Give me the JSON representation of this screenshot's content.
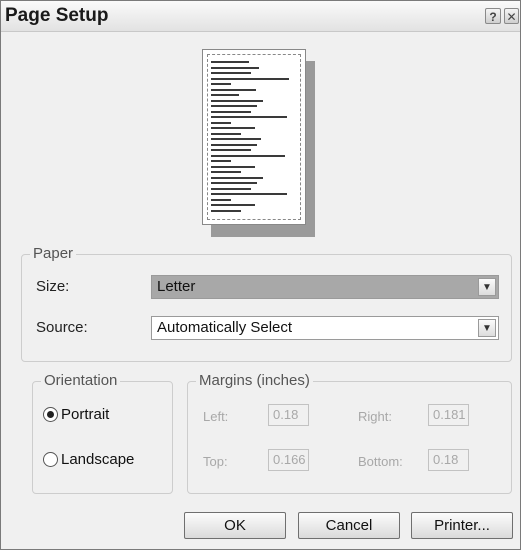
{
  "window": {
    "title": "Page Setup",
    "help_symbol": "?",
    "close_symbol": "✕"
  },
  "paper": {
    "legend": "Paper",
    "size_label": "Size:",
    "size_value": "Letter",
    "source_label": "Source:",
    "source_value": "Automatically Select"
  },
  "orientation": {
    "legend": "Orientation",
    "options": [
      "Portrait",
      "Landscape"
    ],
    "selected": "Portrait"
  },
  "margins": {
    "legend": "Margins (inches)",
    "left_label": "Left:",
    "left_value": "0.18",
    "right_label": "Right:",
    "right_value": "0.181",
    "top_label": "Top:",
    "top_value": "0.166",
    "bottom_label": "Bottom:",
    "bottom_value": "0.18"
  },
  "buttons": {
    "ok": "OK",
    "cancel": "Cancel",
    "printer": "Printer..."
  },
  "icons": {
    "dropdown": "chevron-down-icon",
    "help": "help-icon",
    "close": "close-icon"
  }
}
